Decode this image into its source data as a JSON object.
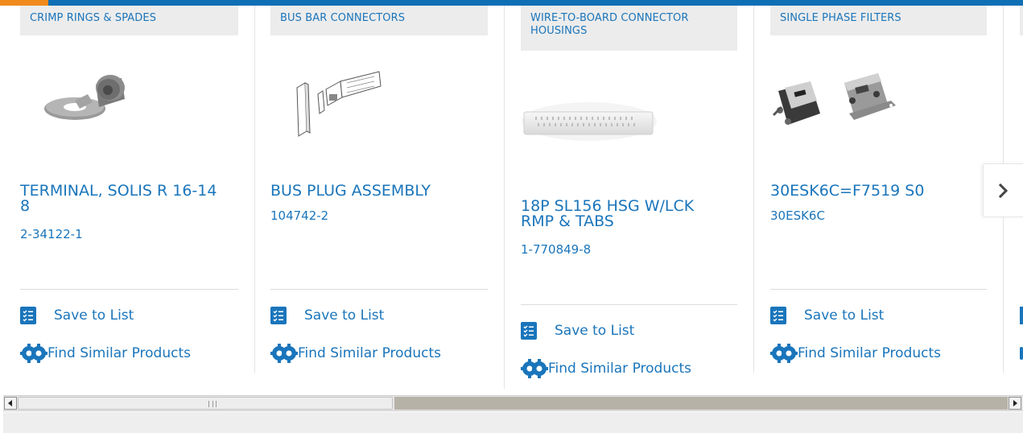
{
  "products": [
    {
      "category": "CRIMP RINGS & SPADES",
      "title": "TERMINAL, SOLIS R 16-14 8",
      "part_number": "2-34122-1",
      "image_icon": "ring-terminal-image"
    },
    {
      "category": "BUS BAR CONNECTORS",
      "title": "BUS PLUG ASSEMBLY",
      "part_number": "104742-2",
      "image_icon": "bus-plug-image"
    },
    {
      "category": "WIRE-TO-BOARD CONNECTOR HOUSINGS",
      "title": "18P SL156 HSG W/LCK RMP & TABS",
      "part_number": "1-770849-8",
      "image_icon": "connector-housing-image"
    },
    {
      "category": "SINGLE PHASE FILTERS",
      "title": "30ESK6C=F7519 S0",
      "part_number": "30ESK6C",
      "image_icon": "filter-image"
    }
  ],
  "actions": {
    "save_label": "Save to List",
    "similar_label": "Find Similar Products"
  },
  "colors": {
    "link": "#1a75bb",
    "accent": "#f08a1d",
    "brand_bar": "#0e6fb5"
  }
}
